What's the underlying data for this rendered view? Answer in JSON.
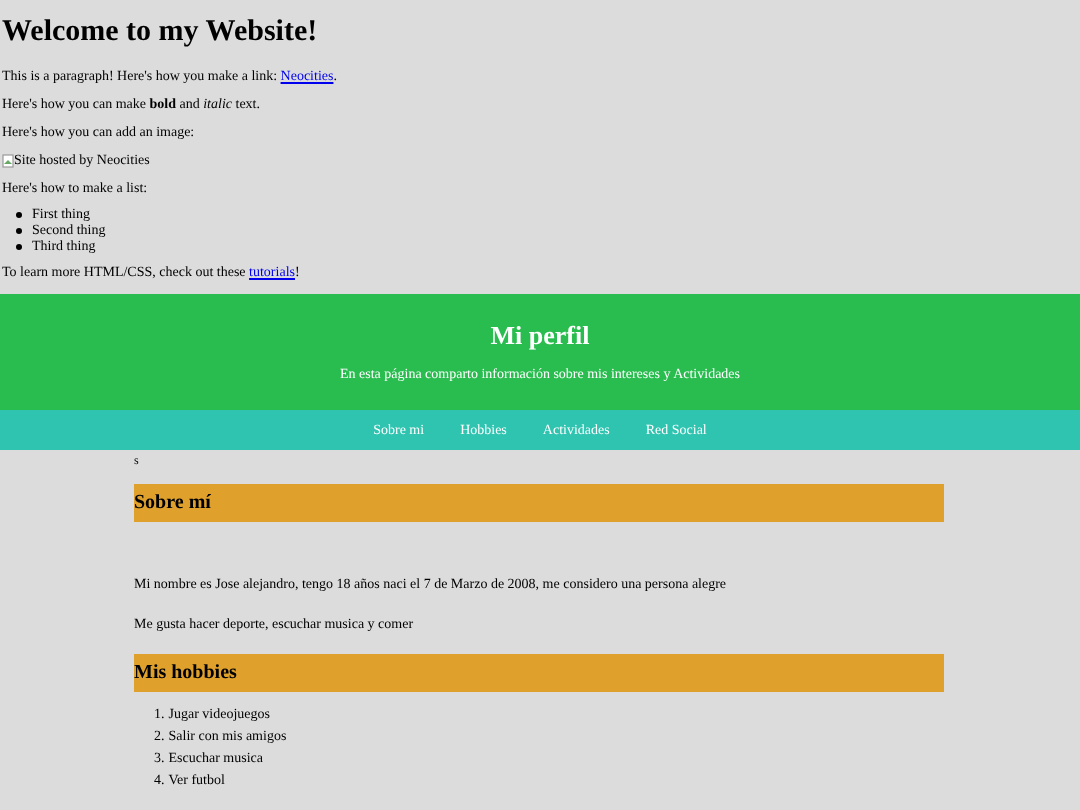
{
  "intro": {
    "title": "Welcome to my Website!",
    "link_paragraph": "This is a paragraph! Here's how you make a link: ",
    "link": "Neocities",
    "link_end": ".",
    "format_paragraph": "Here's how you can make **bold** and *italic* text.",
    "image_paragraph": "Here's how you can add an image:",
    "image_alt": "Site hosted by Neocities",
    "list_paragraph": "Here's how to make a list:",
    "list": [
      "First thing",
      "Second thing",
      "Third thing"
    ],
    "tutorials_paragraph": "To learn more HTML/CSS, check out these ",
    "tutorials_link": "tutorials",
    "tutorials_end": "!"
  },
  "header": {
    "title": "Mi perfil",
    "subtitle": "En esta página comparto información sobre mis intereses y Actividades"
  },
  "nav": [
    "Sobre mi",
    "Hobbies",
    "Actividades",
    "Red Social"
  ],
  "stray_text": "s",
  "about": {
    "heading": "Sobre mí",
    "paragraphs": [
      "Mi nombre es Jose alejandro, tengo 18 años naci el 7 de Marzo de 2008, me considero una persona alegre",
      "Me gusta hacer deporte, escuchar musica y comer"
    ]
  },
  "hobbies": {
    "heading": "Mis hobbies",
    "items": [
      {
        "number": "1.",
        "text": "Jugar videojuegos"
      },
      {
        "number": "2.",
        "text": "Salir con mis amigos"
      },
      {
        "number": "3.",
        "text": "Escuchar musica"
      },
      {
        "number": "4.",
        "text": "Ver futbol"
      }
    ]
  }
}
